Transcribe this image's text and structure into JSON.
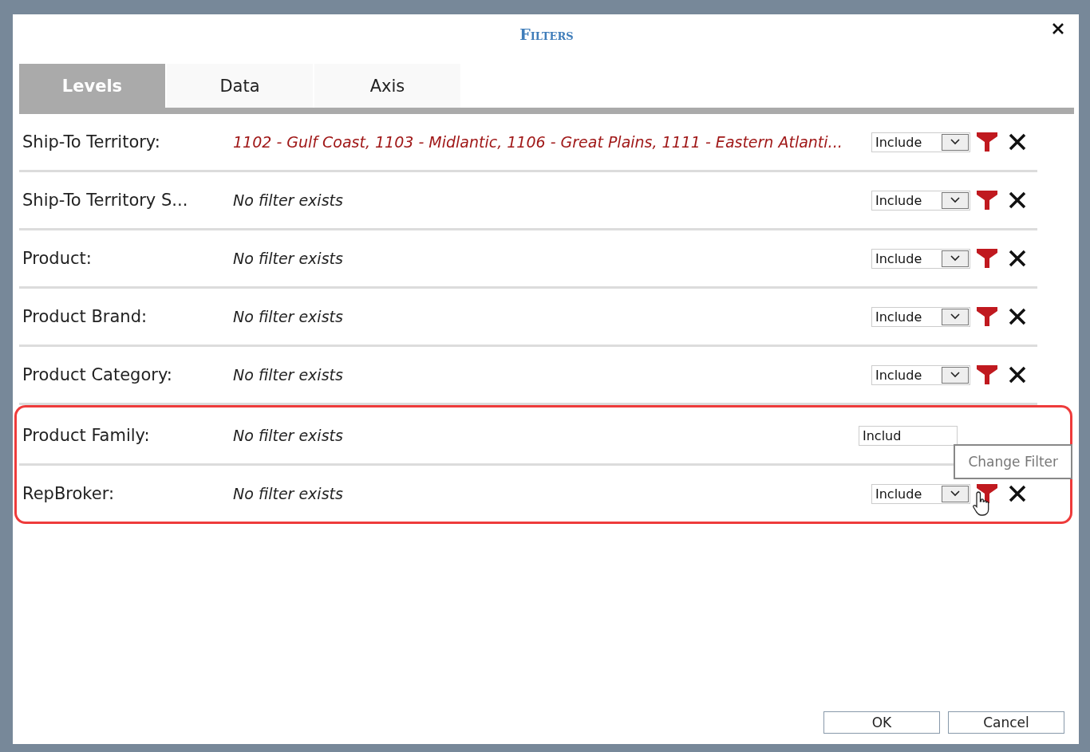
{
  "window": {
    "title": "Filters"
  },
  "tabs": [
    {
      "label": "Levels",
      "selected": true
    },
    {
      "label": "Data",
      "selected": false
    },
    {
      "label": "Axis",
      "selected": false
    }
  ],
  "rows": [
    {
      "label": "Ship-To Territory:",
      "value": "1102 - Gulf Coast, 1103 - Midlantic, 1106 - Great Plains, 1111 - Eastern Atlanti...",
      "has_filter": true,
      "mode": "Include",
      "covered": false,
      "highlighted": false
    },
    {
      "label": "Ship-To Territory S...",
      "value": "No filter exists",
      "has_filter": false,
      "mode": "Include",
      "covered": false,
      "highlighted": false
    },
    {
      "label": "Product:",
      "value": "No filter exists",
      "has_filter": false,
      "mode": "Include",
      "covered": false,
      "highlighted": false
    },
    {
      "label": "Product Brand:",
      "value": "No filter exists",
      "has_filter": false,
      "mode": "Include",
      "covered": false,
      "highlighted": false
    },
    {
      "label": "Product Category:",
      "value": "No filter exists",
      "has_filter": false,
      "mode": "Include",
      "covered": false,
      "highlighted": false
    },
    {
      "label": "Product Family:",
      "value": "No filter exists",
      "has_filter": false,
      "mode": "Includ",
      "covered": true,
      "highlighted": true
    },
    {
      "label": "RepBroker:",
      "value": "No filter exists",
      "has_filter": false,
      "mode": "Include",
      "covered": false,
      "highlighted": true
    }
  ],
  "tooltip": "Change Filter",
  "buttons": [
    "OK",
    "Cancel"
  ]
}
